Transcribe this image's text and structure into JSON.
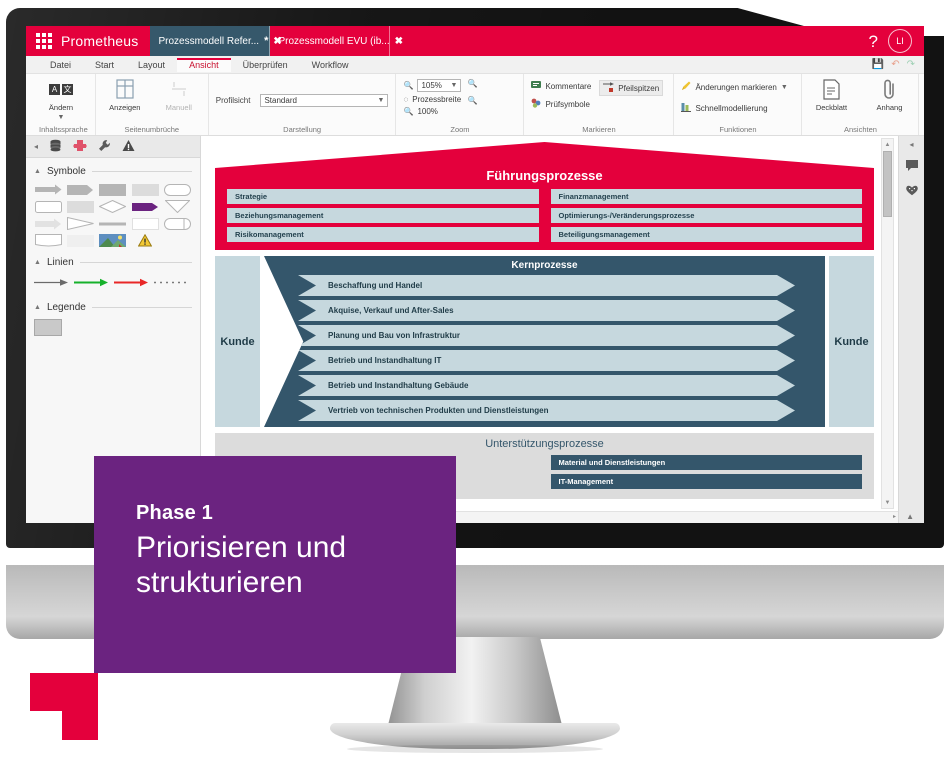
{
  "app": {
    "brand": "Prometheus",
    "brand_icon": "waffle-grid-icon",
    "help_icon": "?",
    "avatar_initials": "LI",
    "accent_red": "#E4003C",
    "accent_teal": "#34566B",
    "accent_lightblue": "#C6D8DE",
    "accent_purple": "#6B2380"
  },
  "document_tabs": [
    {
      "label": "Prozessmodell Refer...",
      "dirty": "*",
      "close": "✖",
      "active": true
    },
    {
      "label": "Prozessmodell EVU (ib...",
      "dirty": "",
      "close": "✖",
      "active": false
    }
  ],
  "ribbon_tabs": [
    {
      "label": "Datei"
    },
    {
      "label": "Start"
    },
    {
      "label": "Layout"
    },
    {
      "label": "Ansicht",
      "active": true
    },
    {
      "label": "Überprüfen"
    },
    {
      "label": "Workflow"
    }
  ],
  "quick_access": [
    {
      "name": "save-icon",
      "glyph": "💾"
    },
    {
      "name": "undo-icon",
      "glyph": "↶"
    },
    {
      "name": "redo-icon",
      "glyph": "↷"
    }
  ],
  "ribbon_groups": [
    {
      "title": "Inhaltssprache",
      "buttons": [
        {
          "label": "Ändern",
          "icon": "language-change-icon",
          "a": "A",
          "b": "文",
          "caret": "▼",
          "disabled": false
        }
      ]
    },
    {
      "title": "Seitenumbrüche",
      "buttons": [
        {
          "label": "Anzeigen",
          "icon": "page-break-show-icon",
          "disabled": false
        },
        {
          "label": "Manuell",
          "icon": "page-break-manual-icon",
          "disabled": true
        }
      ]
    },
    {
      "title": "Darstellung",
      "field_label": "Profilsicht",
      "field_value": "Standard",
      "field_caret": "▼"
    },
    {
      "title": "Zoom",
      "zoom_value": "105%",
      "zoom_caret": "▼",
      "items": [
        {
          "label": "Prozessbreite",
          "icon": "fit-width-icon"
        },
        {
          "label": "100%",
          "icon": "zoom-100-icon"
        }
      ],
      "zoom_in_icon": "zoom-in-icon",
      "zoom_out_icon": "zoom-out-icon"
    },
    {
      "title": "Markieren",
      "items": [
        {
          "label": "Kommentare",
          "icon": "comments-icon",
          "boxed": false
        },
        {
          "label": "Pfeilspitzen",
          "icon": "arrowheads-icon",
          "boxed": true
        },
        {
          "label": "Prüfsymbole",
          "icon": "check-symbols-icon",
          "boxed": false
        }
      ]
    },
    {
      "title": "Funktionen",
      "items": [
        {
          "label": "Änderungen markieren",
          "icon": "highlight-changes-icon",
          "caret": "▼"
        },
        {
          "label": "Schnellmodellierung",
          "icon": "quick-modelling-icon"
        }
      ]
    },
    {
      "title": "Ansichten",
      "buttons": [
        {
          "label": "Deckblatt",
          "icon": "cover-sheet-icon"
        },
        {
          "label": "Anhang",
          "icon": "attachment-icon"
        }
      ]
    }
  ],
  "ribbon_collapse_icon": "▲",
  "left_panel": {
    "collapse_icon": "◂",
    "toolbar_icons": [
      {
        "name": "data-stack-icon",
        "glyph": "⌸"
      },
      {
        "name": "puzzle-icon",
        "glyph": "❖",
        "active": true
      },
      {
        "name": "wrench-icon",
        "glyph": "ὒ7"
      },
      {
        "name": "warning-icon",
        "glyph": "⚠"
      }
    ],
    "sections": [
      {
        "title": "Symbole",
        "tri": "▲"
      },
      {
        "title": "Linien",
        "tri": "▲"
      },
      {
        "title": "Legende",
        "tri": "▲"
      }
    ],
    "symbol_count": 20,
    "line_styles": [
      "arrow-grey",
      "arrow-green",
      "arrow-red",
      "dotted"
    ]
  },
  "right_rail": {
    "collapse_icon": "◂",
    "icons": [
      {
        "name": "comment-bubble-icon",
        "glyph": "💬"
      },
      {
        "name": "favourites-heart-icon",
        "glyph": "♥"
      }
    ]
  },
  "scrollbars": {
    "up_arrow": "▲",
    "down_arrow": "▼",
    "right_arrow": "▸"
  },
  "diagram": {
    "leadership": {
      "title": "Führungsprozesse",
      "left_items": [
        "Strategie",
        "Beziehungsmanagement",
        "Risikomanagement"
      ],
      "right_items": [
        "Finanzmanagement",
        "Optimierungs-/Veränderungsprozesse",
        "Beteiligungsmanagement"
      ]
    },
    "core": {
      "title": "Kernprozesse",
      "left_label": "Kunde",
      "right_label": "Kunde",
      "processes": [
        "Beschaffung und Handel",
        "Akquise, Verkauf und After-Sales",
        "Planung und Bau von Infrastruktur",
        "Betrieb und Instandhaltung IT",
        "Betrieb und Instandhaltung Gebäude",
        "Vertrieb von technischen Produkten und Dienstleistungen"
      ]
    },
    "support": {
      "title": "Unterstützungsprozesse",
      "left_items": [
        "",
        ""
      ],
      "right_items": [
        "Material und Dienstleistungen",
        "IT-Management"
      ]
    }
  },
  "callout": {
    "phase": "Phase 1",
    "headline": "Priorisieren und strukturieren"
  }
}
